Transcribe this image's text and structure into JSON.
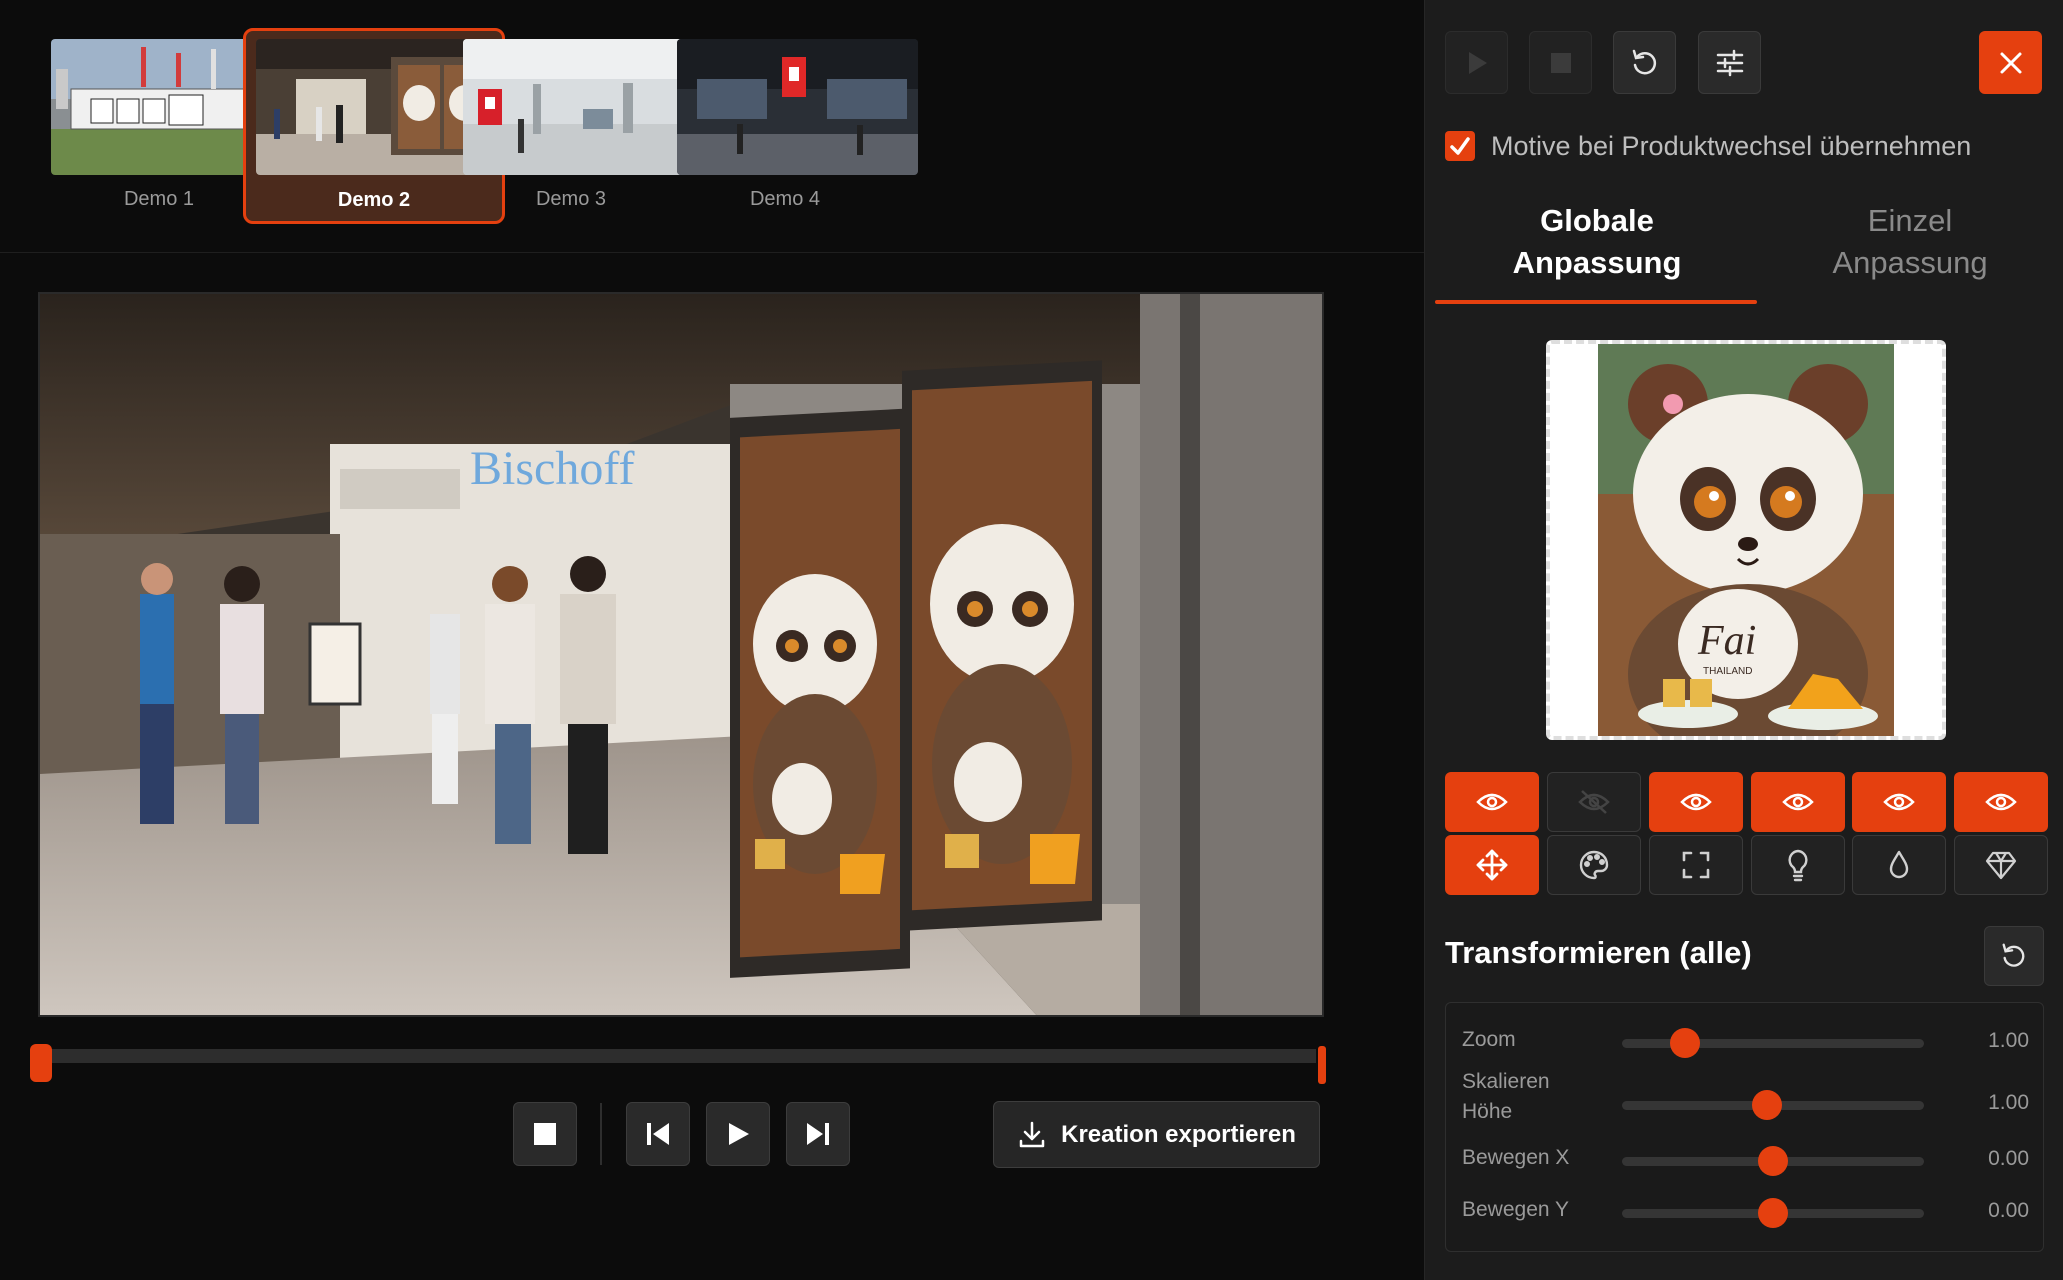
{
  "thumbnails": [
    {
      "label": "Demo 1",
      "active": false
    },
    {
      "label": "Demo 2",
      "active": true
    },
    {
      "label": "Demo 3",
      "active": false
    },
    {
      "label": "Demo 4",
      "active": false
    }
  ],
  "viewer": {
    "store_sign": "Bischoff"
  },
  "timeline": {
    "start": 0,
    "end": 1
  },
  "player": {
    "export_label": "Kreation exportieren"
  },
  "panel": {
    "keep_motifs_label": "Motive bei Produktwechsel übernehmen",
    "keep_motifs_checked": true,
    "tab_global_line1": "Globale",
    "tab_global_line2": "Anpassung",
    "tab_single_line1": "Einzel",
    "tab_single_line2": "Anpassung",
    "motif_brand": "Fai",
    "motif_brand_sub": "THAILAND",
    "visibility": [
      true,
      false,
      true,
      true,
      true,
      true
    ],
    "tools": [
      "move-icon",
      "palette-icon",
      "fullscreen-icon",
      "bulb-icon",
      "drop-icon",
      "diamond-icon"
    ],
    "section_title": "Transformieren (alle)",
    "sliders": [
      {
        "label_line1": "Zoom",
        "label_line2": "",
        "value": "1.00",
        "position": 0.21
      },
      {
        "label_line1": "Skalieren",
        "label_line2": "Höhe",
        "value": "1.00",
        "position": 0.48
      },
      {
        "label_line1": "Bewegen X",
        "label_line2": "",
        "value": "0.00",
        "position": 0.5
      },
      {
        "label_line1": "Bewegen Y",
        "label_line2": "",
        "value": "0.00",
        "position": 0.5
      }
    ]
  },
  "colors": {
    "accent": "#e5400f",
    "panel_bg": "#1c1c1c",
    "bg": "#0c0c0c"
  }
}
